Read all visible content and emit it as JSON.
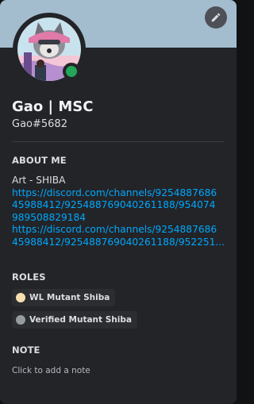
{
  "profile": {
    "display_name": "Gao | MSC",
    "username": "Gao#5682",
    "status": "online",
    "banner_color": "#a3bdcf"
  },
  "about": {
    "title": "ABOUT ME",
    "text_line": "Art - SHIBA",
    "link1_line1": "https://discord.com/channels/9254887686",
    "link1_line2": "45988412/925488769040261188/954074",
    "link1_line3": "989508829184",
    "link2_line1": "https://discord.com/channels/9254887686",
    "link2_line2": "45988412/925488769040261188/952251..."
  },
  "roles": {
    "title": "ROLES",
    "items": [
      {
        "label": "WL Mutant Shiba",
        "color": "#f9deb0"
      },
      {
        "label": "Verified Mutant Shiba",
        "color": "#979c9f"
      }
    ]
  },
  "note": {
    "title": "NOTE",
    "placeholder": "Click to add a note"
  },
  "colors": {
    "link": "#00a8fc",
    "online": "#23a55a",
    "card_bg": "#232428"
  }
}
